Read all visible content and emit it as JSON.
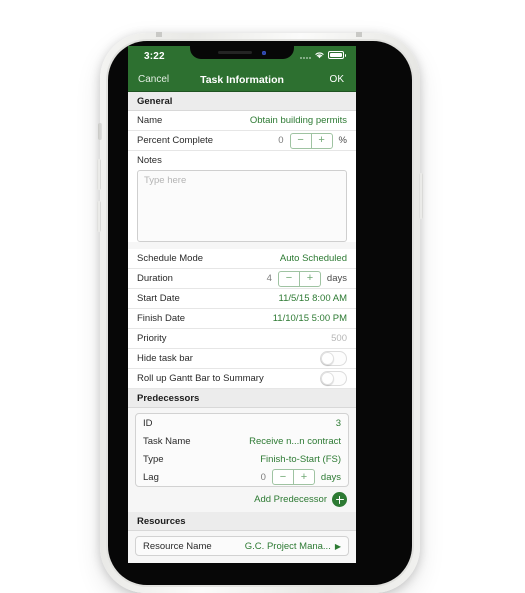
{
  "device": {
    "status_bar": {
      "time": "3:22",
      "signal_icon": "signal-dots-icon",
      "wifi_icon": "wifi-icon",
      "battery_icon": "battery-icon"
    },
    "notch": {
      "speaker_icon": "speaker-slot-icon",
      "camera_icon": "front-camera-icon"
    },
    "buttons": {
      "mute_switch": "mute-switch",
      "volume_up": "volume-up-button",
      "volume_down": "volume-down-button",
      "power": "power-button"
    }
  },
  "nav": {
    "cancel_label": "Cancel",
    "title": "Task Information",
    "ok_label": "OK"
  },
  "general": {
    "section_label": "General",
    "name_label": "Name",
    "name_value": "Obtain building permits",
    "percent_label": "Percent Complete",
    "percent_value": "0",
    "percent_minus": "−",
    "percent_plus": "+",
    "percent_unit": "%",
    "notes_label": "Notes",
    "notes_placeholder": "Type here",
    "notes_value": "",
    "schedule_mode_label": "Schedule Mode",
    "schedule_mode_value": "Auto Scheduled",
    "duration_label": "Duration",
    "duration_value": "4",
    "duration_minus": "−",
    "duration_plus": "+",
    "duration_unit": "days",
    "start_date_label": "Start Date",
    "start_date_value": "11/5/15 8:00 AM",
    "finish_date_label": "Finish Date",
    "finish_date_value": "11/10/15 5:00 PM",
    "priority_label": "Priority",
    "priority_value": "500",
    "hide_task_bar_label": "Hide task bar",
    "hide_task_bar_state": "off",
    "roll_up_label": "Roll up Gantt Bar to Summary",
    "roll_up_state": "off"
  },
  "predecessors": {
    "section_label": "Predecessors",
    "id_label": "ID",
    "id_value": "3",
    "task_name_label": "Task Name",
    "task_name_value": "Receive n...n contract",
    "type_label": "Type",
    "type_value": "Finish-to-Start (FS)",
    "lag_label": "Lag",
    "lag_value": "0",
    "lag_minus": "−",
    "lag_plus": "+",
    "lag_unit": "days",
    "add_label": "Add Predecessor",
    "add_icon": "plus-circle-icon"
  },
  "resources": {
    "section_label": "Resources",
    "resource_name_label": "Resource Name",
    "resource_name_value": "G.C. Project Mana...",
    "disclosure_icon": "▶"
  },
  "colors": {
    "brand_green": "#2d7030",
    "value_green": "#2d7a33",
    "muted_gray": "#b7b7b7",
    "section_bg": "#ececec"
  }
}
